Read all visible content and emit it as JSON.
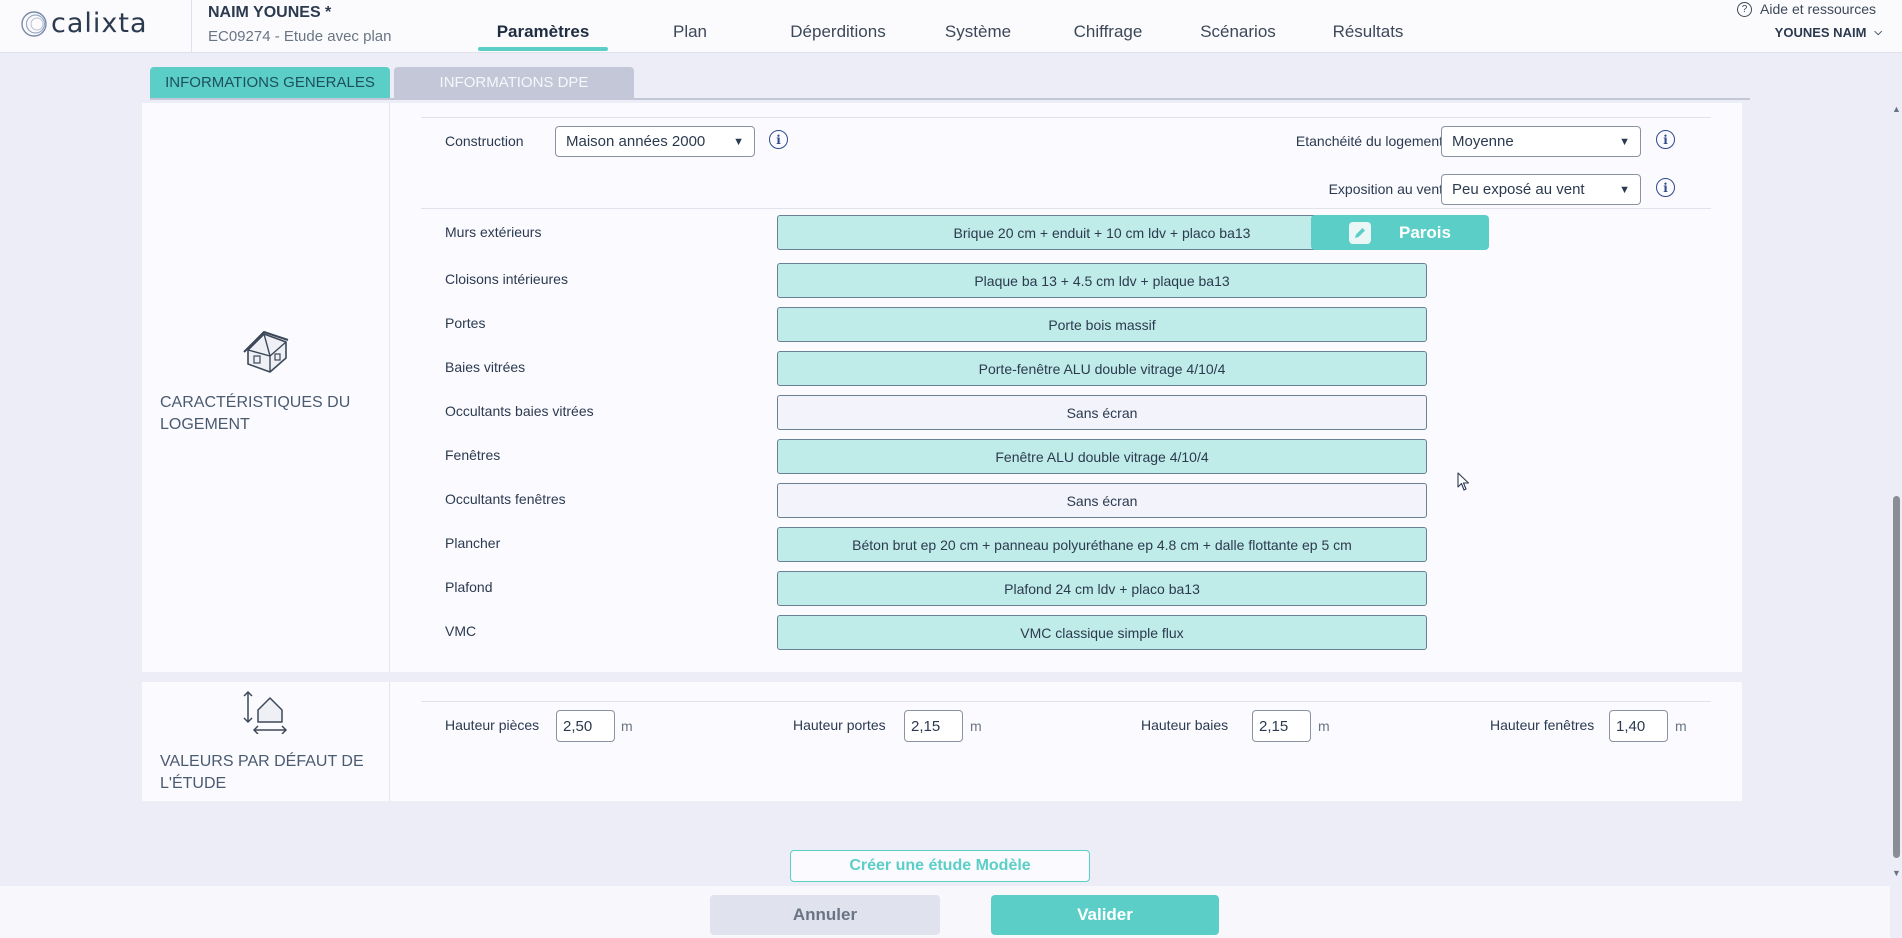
{
  "header": {
    "logo_text": "CALIXTA",
    "user_name": "NAIM YOUNES *",
    "study_id": "EC09274 - Etude avec plan",
    "nav_tabs": [
      {
        "label": "Paramètres",
        "active": true
      },
      {
        "label": "Plan",
        "active": false
      },
      {
        "label": "Déperditions",
        "active": false
      },
      {
        "label": "Système",
        "active": false
      },
      {
        "label": "Chiffrage",
        "active": false
      },
      {
        "label": "Scénarios",
        "active": false
      },
      {
        "label": "Résultats",
        "active": false
      }
    ],
    "help_label": "Aide et ressources",
    "account_name": "YOUNES NAIM"
  },
  "subtabs": [
    {
      "label": "INFORMATIONS GENERALES",
      "active": true
    },
    {
      "label": "INFORMATIONS DPE",
      "active": false
    }
  ],
  "characteristics": {
    "title": "CARACTÉRISTIQUES DU LOGEMENT",
    "construction_label": "Construction",
    "construction_value": "Maison années 2000",
    "airtightness_label": "Etanchéité du logement",
    "airtightness_value": "Moyenne",
    "wind_label": "Exposition au vent",
    "wind_value": "Peu exposé au vent",
    "parois_button": "Parois",
    "components": [
      {
        "label": "Murs extérieurs",
        "value": "Brique 20 cm + enduit + 10 cm ldv + placo ba13",
        "empty": false
      },
      {
        "label": "Cloisons intérieures",
        "value": "Plaque ba 13 + 4.5 cm ldv + plaque ba13",
        "empty": false
      },
      {
        "label": "Portes",
        "value": "Porte bois massif",
        "empty": false
      },
      {
        "label": "Baies vitrées",
        "value": "Porte-fenêtre ALU double vitrage 4/10/4",
        "empty": false
      },
      {
        "label": "Occultants baies vitrées",
        "value": "Sans écran",
        "empty": true
      },
      {
        "label": "Fenêtres",
        "value": "Fenêtre ALU double vitrage 4/10/4",
        "empty": false
      },
      {
        "label": "Occultants fenêtres",
        "value": "Sans écran",
        "empty": true
      },
      {
        "label": "Plancher",
        "value": "Béton brut ep 20 cm + panneau polyuréthane ep 4.8 cm + dalle flottante ep 5 cm",
        "empty": false
      },
      {
        "label": "Plafond",
        "value": "Plafond 24 cm ldv + placo ba13",
        "empty": false
      },
      {
        "label": "VMC",
        "value": "VMC classique simple flux",
        "empty": false
      }
    ]
  },
  "defaults": {
    "title": "VALEURS PAR DÉFAUT DE L'ÉTUDE",
    "fields": [
      {
        "label": "Hauteur pièces",
        "value": "2,50",
        "unit": "m"
      },
      {
        "label": "Hauteur portes",
        "value": "2,15",
        "unit": "m"
      },
      {
        "label": "Hauteur baies",
        "value": "2,15",
        "unit": "m"
      },
      {
        "label": "Hauteur fenêtres",
        "value": "1,40",
        "unit": "m"
      }
    ]
  },
  "actions": {
    "template_button": "Créer une étude Modèle",
    "cancel_button": "Annuler",
    "validate_button": "Valider"
  },
  "colors": {
    "accent": "#5bcfc7",
    "component_fill": "#bfece8",
    "background": "#ecedf7"
  }
}
